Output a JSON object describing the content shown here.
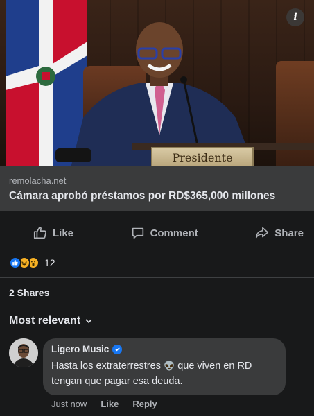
{
  "post_image": {
    "nameplate_text": "Presidente",
    "info_label": "i"
  },
  "link_preview": {
    "domain": "remolacha.net",
    "title": "Cámara aprobó préstamos por RD$365,000 millones"
  },
  "actions": {
    "like": "Like",
    "comment": "Comment",
    "share": "Share"
  },
  "reactions": {
    "count": "12"
  },
  "shares_text": "2 Shares",
  "sort_label": "Most relevant",
  "comment": {
    "author": "Ligero Music",
    "text_before": "Hasta los extraterrestres ",
    "emoji": "👽",
    "text_after": " que viven en RD tengan que pagar esa deuda.",
    "time": "Just now",
    "like_link": "Like",
    "reply_link": "Reply"
  },
  "colors": {
    "background": "#18191a",
    "surface": "#3a3b3c",
    "accent_blue": "#1877f2",
    "text_primary": "#e4e6eb",
    "text_secondary": "#b0b3b8"
  }
}
